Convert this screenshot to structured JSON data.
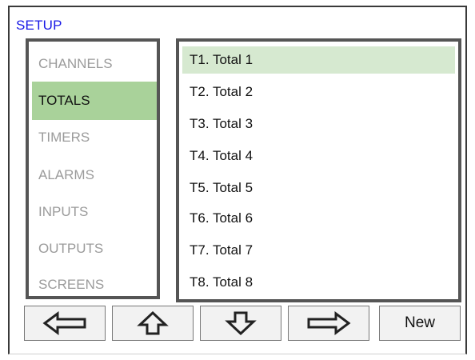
{
  "setup": {
    "title": "SETUP"
  },
  "nav": {
    "items": [
      {
        "label": "CHANNELS",
        "active": false
      },
      {
        "label": "TOTALS",
        "active": true
      },
      {
        "label": "TIMERS",
        "active": false
      },
      {
        "label": "ALARMS",
        "active": false
      },
      {
        "label": "INPUTS",
        "active": false
      },
      {
        "label": "OUTPUTS",
        "active": false
      },
      {
        "label": "SCREENS",
        "active": false
      }
    ]
  },
  "totals": {
    "items": [
      {
        "label": "T1. Total 1",
        "selected": true
      },
      {
        "label": "T2. Total 2",
        "selected": false
      },
      {
        "label": "T3. Total 3",
        "selected": false
      },
      {
        "label": "T4. Total 4",
        "selected": false
      },
      {
        "label": "T5. Total 5",
        "selected": false
      },
      {
        "label": "T6. Total 6",
        "selected": false
      },
      {
        "label": "T7. Total 7",
        "selected": false
      },
      {
        "label": "T8. Total 8",
        "selected": false
      }
    ]
  },
  "toolbar": {
    "left_icon": "arrow-left-icon",
    "up_icon": "arrow-up-icon",
    "down_icon": "arrow-down-icon",
    "right_icon": "arrow-right-icon",
    "new_label": "New"
  },
  "colors": {
    "title": "#1a1ae6",
    "active_nav_bg": "#a9d29a",
    "selected_item_bg": "#d6e9d0",
    "panel_border": "#555555",
    "inactive_text": "#9b9b9b"
  }
}
